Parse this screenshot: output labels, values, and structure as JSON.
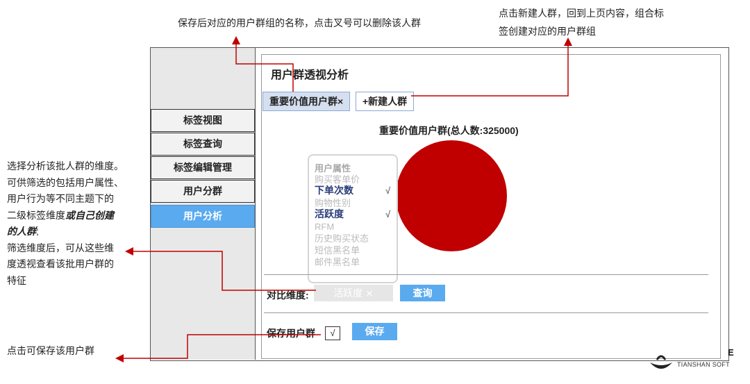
{
  "annotations": {
    "top_left": "保存后对应的用户群组的名称，点击叉号可以删除该人群",
    "top_right_line1": "点击新建人群，回到上页内容，组合标",
    "top_right_line2": "签创建对应的用户群组",
    "left_line1": "选择分析该批人群的维度。",
    "left_line2": "可供筛选的包括用户属性、",
    "left_line3": "用户行为等不同主题下的",
    "left_line4_plain": "二级标签维度",
    "left_line4_bold": "或自己创建",
    "left_line5_bold": "的人群",
    "left_line5_tail": ";",
    "left_line6": "筛选维度后，可从这些维",
    "left_line7": "度透视查看该批用户群的",
    "left_line8": "特征",
    "bottom_left": "点击可保存该用户群"
  },
  "sidebar": {
    "items": [
      {
        "label": "标签视图",
        "active": false
      },
      {
        "label": "标签查询",
        "active": false
      },
      {
        "label": "标签编辑管理",
        "active": false
      },
      {
        "label": "用户分群",
        "active": false
      },
      {
        "label": "用户分析",
        "active": true
      }
    ]
  },
  "main": {
    "title": "用户群透视分析",
    "tabs": {
      "group_label": "重要价值用户群×",
      "new_label": "+新建人群"
    },
    "chart": {
      "title": "重要价值用户群(总人数:325000)",
      "color": "#c00000"
    },
    "dimensions": {
      "items": [
        {
          "label": "用户属性",
          "kind": "header",
          "checked": ""
        },
        {
          "label": "购买客单价",
          "kind": "option",
          "checked": ""
        },
        {
          "label": "下单次数",
          "kind": "selected",
          "checked": "√"
        },
        {
          "label": "购物性别",
          "kind": "option",
          "checked": ""
        },
        {
          "label": "活跃度",
          "kind": "selected",
          "checked": "√"
        },
        {
          "label": "RFM",
          "kind": "option",
          "checked": ""
        },
        {
          "label": "历史购买状态",
          "kind": "option",
          "checked": ""
        },
        {
          "label": "短信黑名单",
          "kind": "option",
          "checked": ""
        },
        {
          "label": "邮件黑名单",
          "kind": "option",
          "checked": ""
        }
      ]
    },
    "compare": {
      "label": "对比维度:",
      "value": "活跃度 ⨯",
      "query_button": "查询"
    },
    "save": {
      "label": "保存用户群",
      "checkbox_mark": "√",
      "save_button": "保存"
    }
  },
  "logo": {
    "text": "TIANSHAN SOFT",
    "glyph": "E"
  },
  "colors": {
    "accent": "#5aaaf0",
    "annotation_line": "#c00000",
    "tab_bg": "#d5dff0"
  }
}
